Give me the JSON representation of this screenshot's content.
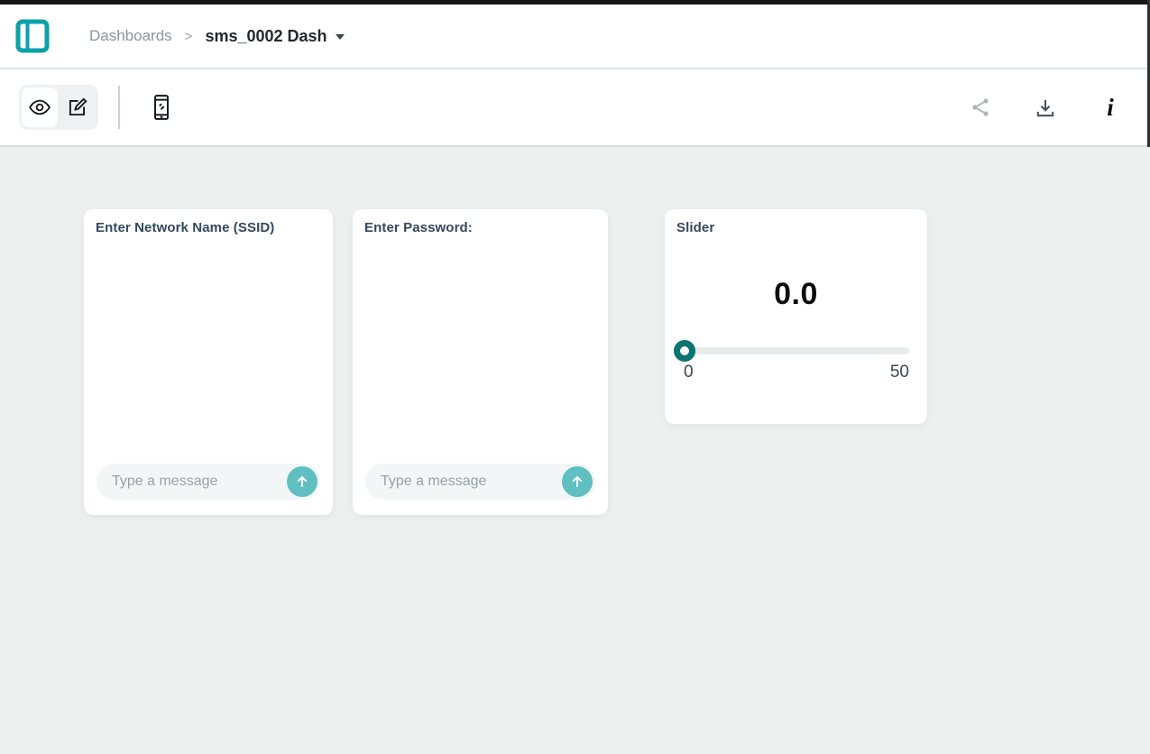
{
  "header": {
    "breadcrumb": {
      "section": "Dashboards",
      "separator": ">",
      "current": "sms_0002 Dash"
    }
  },
  "toolbar": {
    "left_icons": [
      "eye-view-icon",
      "edit-pencil-icon",
      "mobile-phone-icon"
    ],
    "right_icons": [
      "share-icon",
      "download-icon",
      "info-icon"
    ],
    "info_glyph": "i",
    "selected_mode": "view"
  },
  "widgets": {
    "ssid": {
      "title": "Enter Network Name (SSID)",
      "placeholder": "Type a message"
    },
    "password": {
      "title": "Enter Password:",
      "placeholder": "Type a message"
    },
    "slider": {
      "title": "Slider",
      "value": "0.0",
      "min": "0",
      "max": "50"
    }
  },
  "colors": {
    "logo_teal": "#0ba1a8",
    "send_button_teal": "#5fbfc1",
    "slider_thumb_teal": "#0b746e",
    "main_background": "#ecf1f0",
    "title_text": "#33485e",
    "placeholder_text": "#98a0a6"
  }
}
